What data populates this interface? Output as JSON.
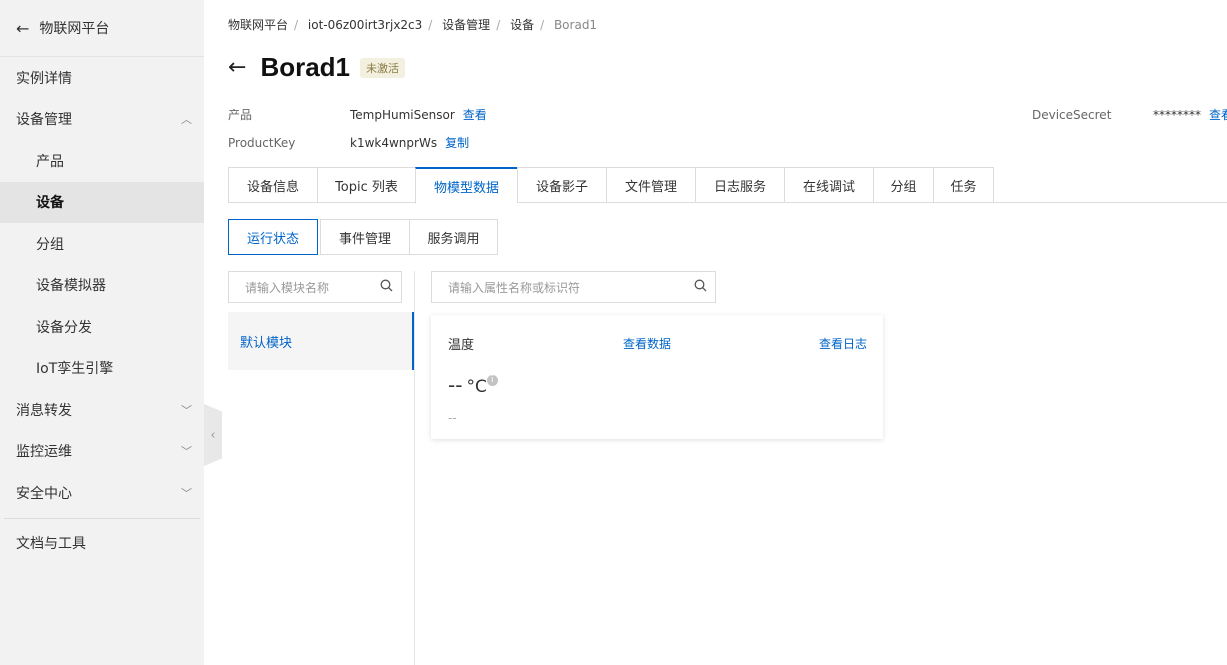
{
  "sidebar": {
    "back_title": "物联网平台",
    "items": [
      {
        "label": "实例详情"
      },
      {
        "label": "设备管理"
      },
      {
        "label": "产品"
      },
      {
        "label": "设备"
      },
      {
        "label": "分组"
      },
      {
        "label": "设备模拟器"
      },
      {
        "label": "设备分发"
      },
      {
        "label": "IoT孪生引擎"
      },
      {
        "label": "消息转发"
      },
      {
        "label": "监控运维"
      },
      {
        "label": "安全中心"
      },
      {
        "label": "文档与工具"
      }
    ]
  },
  "breadcrumb": [
    "物联网平台",
    "iot-06z00irt3rjx2c3",
    "设备管理",
    "设备",
    "Borad1"
  ],
  "header": {
    "title": "Borad1",
    "status": "未激活"
  },
  "info": {
    "product_label": "产品",
    "product_value": "TempHumiSensor",
    "product_link": "查看",
    "productkey_label": "ProductKey",
    "productkey_value": "k1wk4wnprWs",
    "productkey_link": "复制",
    "secret_label": "DeviceSecret",
    "secret_value": "********",
    "secret_link": "查看"
  },
  "tabs": [
    "设备信息",
    "Topic 列表",
    "物模型数据",
    "设备影子",
    "文件管理",
    "日志服务",
    "在线调试",
    "分组",
    "任务"
  ],
  "subtabs": [
    "运行状态",
    "事件管理",
    "服务调用"
  ],
  "module_search": {
    "placeholder": "请输入模块名称"
  },
  "prop_search": {
    "placeholder": "请输入属性名称或标识符"
  },
  "module": {
    "name": "默认模块"
  },
  "card": {
    "name": "温度",
    "view_data": "查看数据",
    "view_log": "查看日志",
    "value": "--",
    "unit": "°C",
    "timestamp": "--"
  },
  "colors": {
    "accent": "#0064c8",
    "sidebar_bg": "#f2f2f2"
  }
}
